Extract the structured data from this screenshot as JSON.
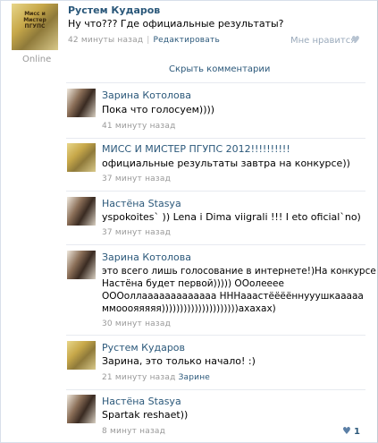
{
  "post": {
    "author": "Рустем Кударов",
    "text": "Ну что??? Где официальные результаты?",
    "time": "42 минуты назад",
    "edit_label": "Редактировать",
    "like_label": "Мне нравится",
    "online": "Online",
    "avatar_caption": "Мисс и Мистер ПГУПС"
  },
  "hide_comments": "Скрыть комментарии",
  "comments": [
    {
      "author": "Зарина Котолова",
      "text": "Пока что голосуем))))",
      "time": "41 минуту назад"
    },
    {
      "author": "МИСС И МИСТЕР ПГУПС 2012!!!!!!!!!!",
      "text": "официальные результаты завтра на конкурсе))",
      "time": "37 минут назад"
    },
    {
      "author": "Настёна Stasya",
      "text": "yspokoites` )) Lena i Dima viigrali !!! I eto oficial`no)",
      "time": "37 минут назад"
    },
    {
      "author": "Зарина Котолова",
      "text": "это всего лишь голосование в интернете!)На конкурсе\nНастёна будет первой))))) ООолееее\nОООоллааааааааааааа ННН​ааастёёёённууушкааааа\nммооояяяяя)))))))))))))))))))))ахахах)",
      "time": "30 минут назад"
    },
    {
      "author": "Рустем Кударов",
      "text": "Зарина, это только начало! :)",
      "time": "21 минуту назад",
      "reply_to": "Зарине"
    },
    {
      "author": "Настёна Stasya",
      "text": "Spartak reshaet))",
      "time": "8 минут назад",
      "likes": "1"
    }
  ]
}
